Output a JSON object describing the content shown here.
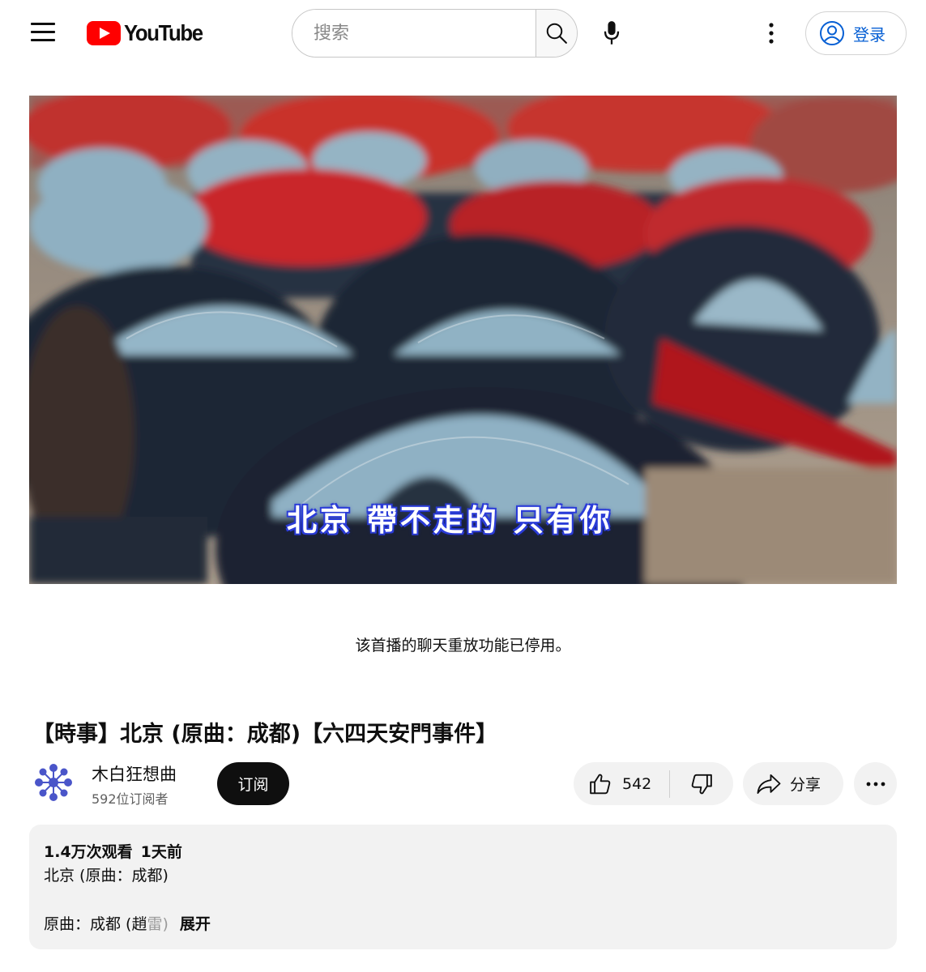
{
  "header": {
    "logo_text": "YouTube",
    "search_placeholder": "搜索",
    "signin_label": "登录"
  },
  "player": {
    "subtitle": "北京 帶不走的 只有你"
  },
  "chat_replay_note": "该首播的聊天重放功能已停用。",
  "video": {
    "title": "【時事】北京 (原曲：成都)【六四天安門事件】"
  },
  "owner": {
    "channel_name": "木白狂想曲",
    "subscriber_count": "592位订阅者",
    "subscribe_label": "订阅"
  },
  "actions": {
    "like_count": "542",
    "share_label": "分享"
  },
  "description": {
    "views": "1.4万次观看",
    "date": "1天前",
    "line1": "北京 (原曲：成都)",
    "line2_prefix": "原曲：成都 (趙",
    "line2_fade": "雷)",
    "expand_label": "展开"
  },
  "colors": {
    "brand_red": "#ff0000",
    "link_blue": "#065fd4",
    "chip_bg": "#f2f2f2"
  }
}
